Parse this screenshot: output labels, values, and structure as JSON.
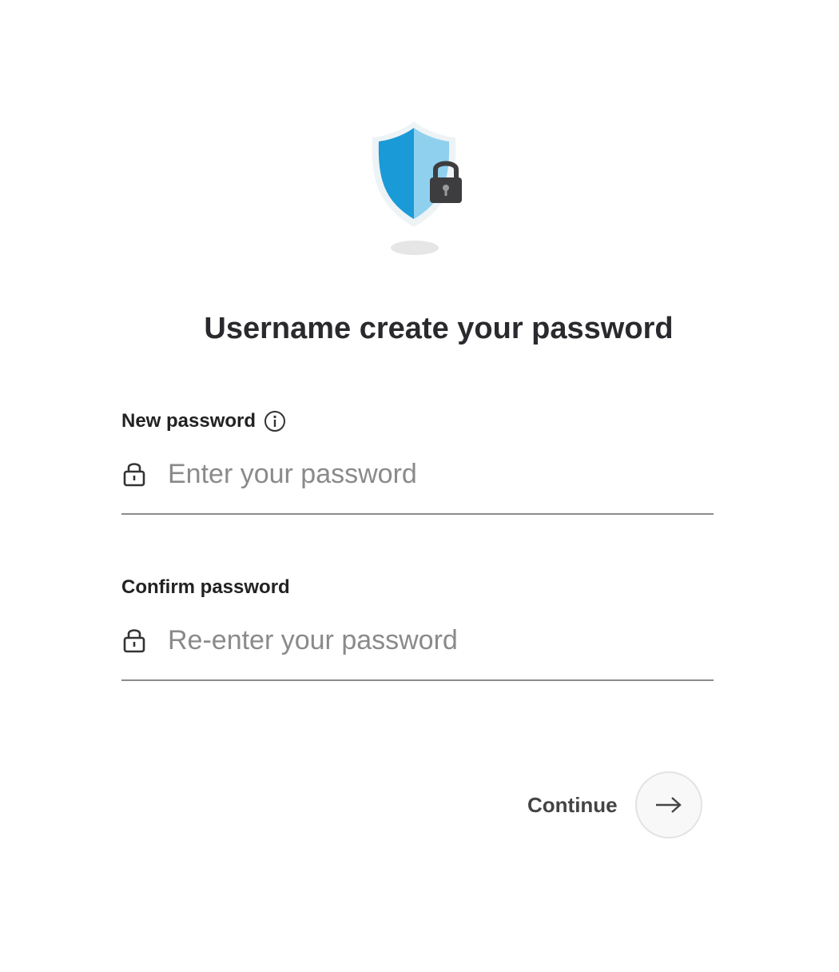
{
  "header": {
    "title": "Username create your password"
  },
  "form": {
    "new_password": {
      "label": "New password",
      "placeholder": "Enter your password",
      "value": ""
    },
    "confirm_password": {
      "label": "Confirm password",
      "placeholder": "Re-enter your password",
      "value": ""
    }
  },
  "actions": {
    "continue_label": "Continue"
  },
  "icons": {
    "hero": "shield-lock-icon",
    "info": "info-icon",
    "lock": "lock-icon",
    "continue": "arrow-right-icon"
  },
  "colors": {
    "shield_dark": "#1a9ad6",
    "shield_light": "#8fd0ef",
    "lock": "#3d3d3f",
    "title": "#2a2a2e",
    "underline": "#8c8c8c"
  }
}
